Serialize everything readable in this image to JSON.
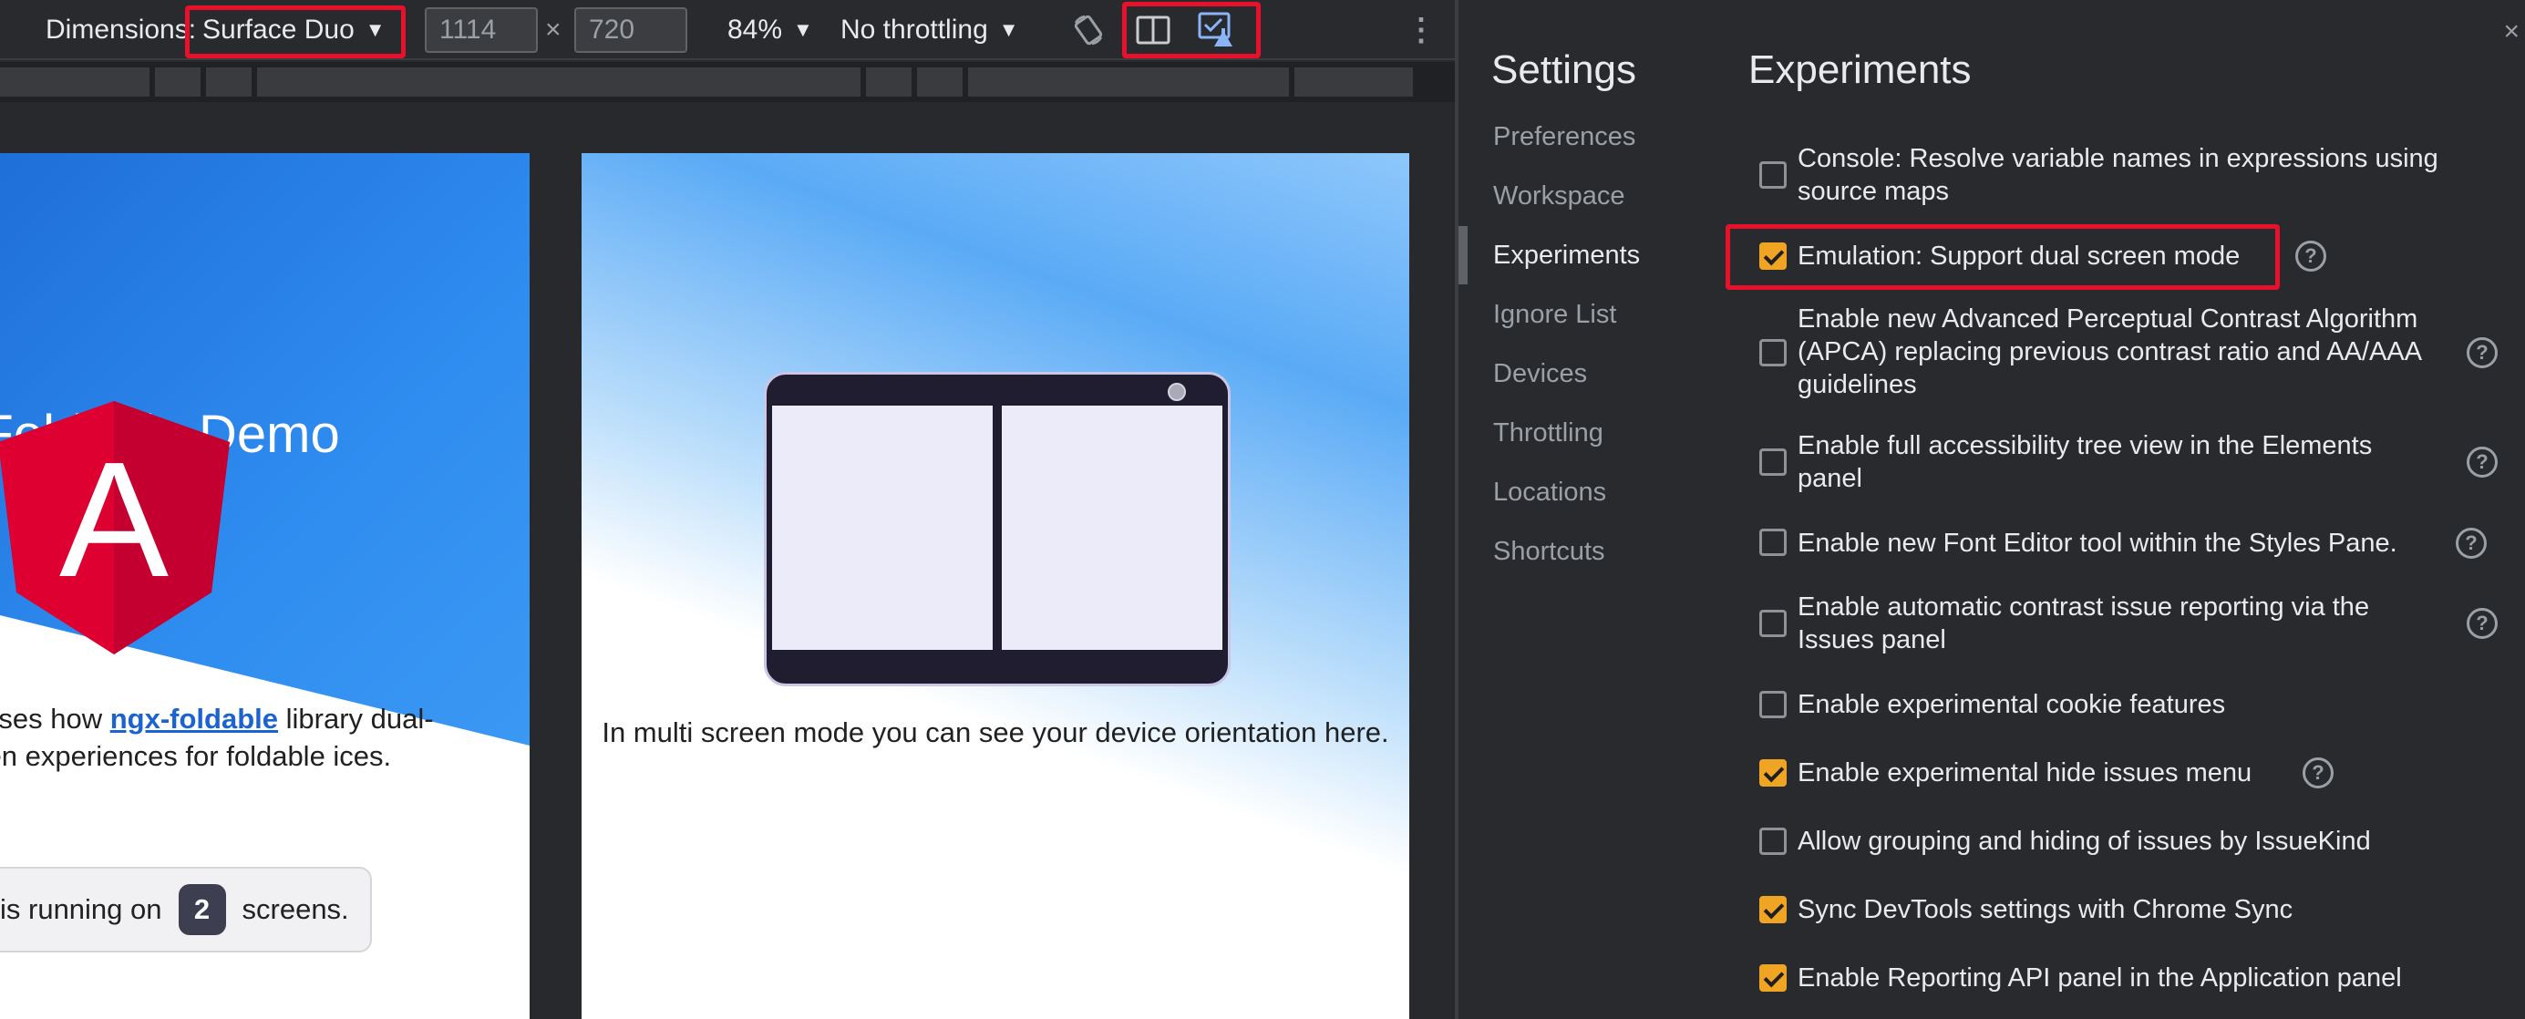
{
  "toolbar": {
    "dimensions_label": "Dimensions:",
    "device": "Surface Duo",
    "width": "1114",
    "times": "×",
    "height": "720",
    "zoom": "84%",
    "throttling": "No throttling",
    "caret": "▼",
    "more_icon": "⋮",
    "icons": [
      "rotate-icon",
      "dual-screen-icon",
      "experimental-mode-icon"
    ]
  },
  "page": {
    "title": "r Foldable Demo",
    "desc_before": "owcases how ",
    "desc_link": "ngx-foldable",
    "desc_after": " library dual-screen experiences for foldable ices.",
    "status_before": "is running on",
    "screen_count": "2",
    "status_after": "screens.",
    "orientation_text": "In multi screen mode you can see your device orientation here.",
    "logo_letter": "A"
  },
  "settings": {
    "title": "Settings",
    "close": "×",
    "nav": [
      "Preferences",
      "Workspace",
      "Experiments",
      "Ignore List",
      "Devices",
      "Throttling",
      "Locations",
      "Shortcuts"
    ],
    "active_nav": "Experiments",
    "experiments_title": "Experiments",
    "help_glyph": "?",
    "experiments": [
      {
        "label": "Console: Resolve variable names in expressions using source maps",
        "checked": false
      },
      {
        "label": "Emulation: Support dual screen mode",
        "checked": true
      },
      {
        "label": "Enable new Advanced Perceptual Contrast Algorithm (APCA) replacing previous contrast ratio and AA/AAA guidelines",
        "checked": false
      },
      {
        "label": "Enable full accessibility tree view in the Elements panel",
        "checked": false
      },
      {
        "label": "Enable new Font Editor tool within the Styles Pane.",
        "checked": false
      },
      {
        "label": "Enable automatic contrast issue reporting via the Issues panel",
        "checked": false
      },
      {
        "label": "Enable experimental cookie features",
        "checked": false
      },
      {
        "label": "Enable experimental hide issues menu",
        "checked": true
      },
      {
        "label": "Allow grouping and hiding of issues by IssueKind",
        "checked": false
      },
      {
        "label": "Sync DevTools settings with Chrome Sync",
        "checked": true
      },
      {
        "label": "Enable Reporting API panel in the Application panel",
        "checked": true
      }
    ]
  },
  "colors": {
    "highlight": "#e8102a",
    "checkbox_on": "#f0a424",
    "link": "#1a63d0",
    "angular_red": "#dd0031"
  }
}
